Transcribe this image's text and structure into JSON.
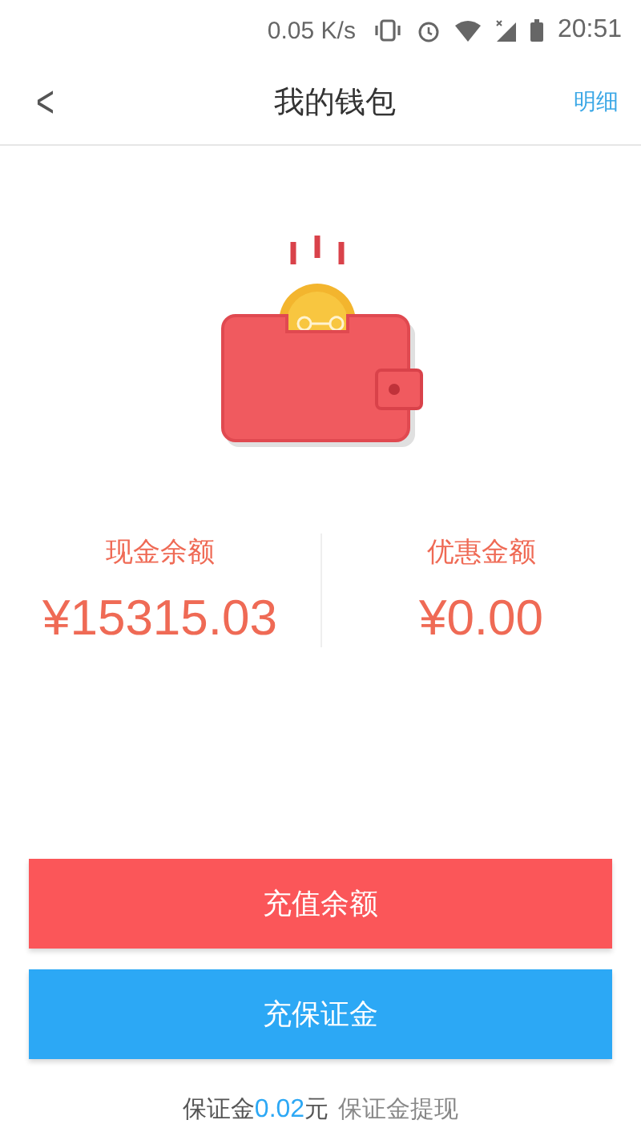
{
  "status_bar": {
    "speed": "0.05 K/s",
    "time": "20:51"
  },
  "header": {
    "back": "<",
    "title": "我的钱包",
    "action": "明细"
  },
  "balances": [
    {
      "label": "现金余额",
      "amount": "¥15315.03"
    },
    {
      "label": "优惠金额",
      "amount": "¥0.00"
    }
  ],
  "buttons": [
    {
      "label": "充值余额",
      "kind": "primary"
    },
    {
      "label": "充保证金",
      "kind": "secondary"
    }
  ],
  "deposit": {
    "prefix": "保证金",
    "amount": "0.02",
    "unit": "元",
    "link": "保证金提现"
  }
}
